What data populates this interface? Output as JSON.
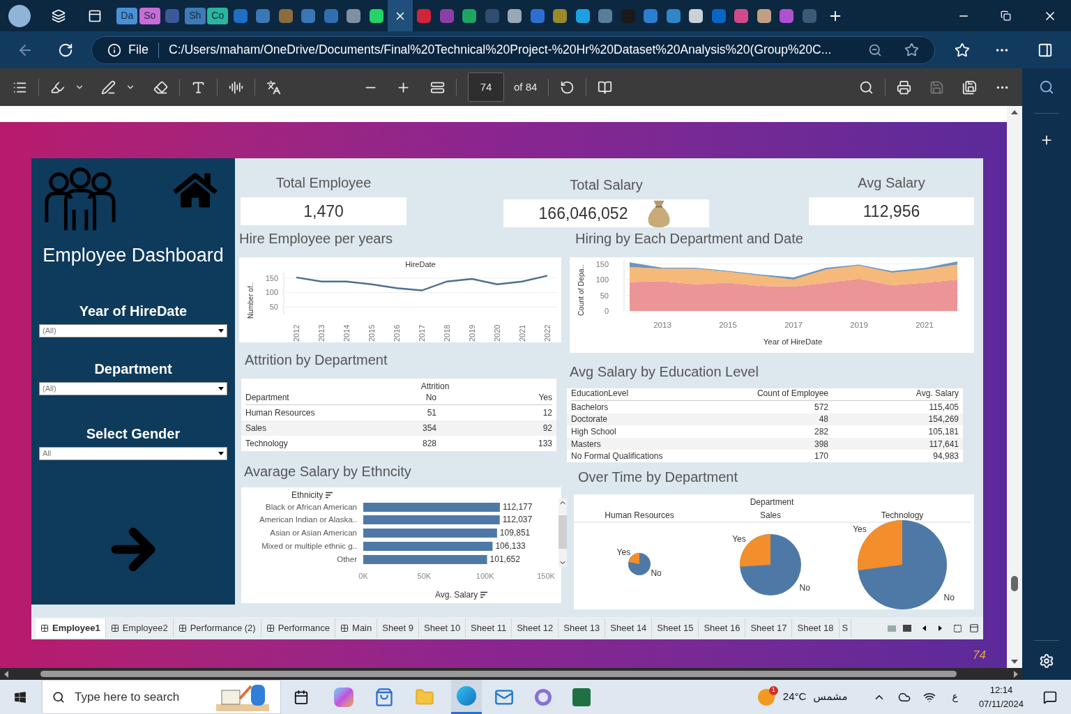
{
  "browser": {
    "tabs": [
      {
        "label": "Da",
        "color": "#4a90d9",
        "selected": false
      },
      {
        "label": "So",
        "color": "#c86dd7",
        "selected": false
      },
      {
        "color": "#3b5998",
        "selected": false
      },
      {
        "label": "Sh",
        "color": "#3d7ab8",
        "selected": false
      },
      {
        "label": "Co",
        "color": "#2bb5a0",
        "selected": false
      },
      {
        "color": "#1f6fc5",
        "selected": false
      },
      {
        "color": "#3a78b5",
        "selected": false
      },
      {
        "color": "#8a6d3b",
        "selected": false
      },
      {
        "color": "#3a78b5",
        "selected": false
      },
      {
        "color": "#2f6fb0",
        "selected": false
      },
      {
        "color": "#8090a0",
        "selected": false
      },
      {
        "color": "#25d366",
        "selected": false
      },
      {
        "selected": true
      },
      {
        "color": "#d0243a",
        "selected": false
      },
      {
        "color": "#8a3fa8",
        "selected": false
      },
      {
        "color": "#1fa463",
        "selected": false
      },
      {
        "color": "#2f4e6d",
        "selected": false
      },
      {
        "color": "#9aa7b4",
        "selected": false
      },
      {
        "color": "#2d6fd0",
        "selected": false
      },
      {
        "color": "#9a8a2a",
        "selected": false
      },
      {
        "color": "#1ea0e0",
        "selected": false
      },
      {
        "color": "#5a7d9a",
        "selected": false
      },
      {
        "color": "#1a1a1a",
        "selected": false
      },
      {
        "color": "#2a7fd0",
        "selected": false
      },
      {
        "color": "#2f86c8",
        "selected": false
      },
      {
        "color": "#c9d1d9",
        "selected": false
      },
      {
        "color": "#0a66c2",
        "selected": false
      },
      {
        "color": "#d04a8a",
        "selected": false
      },
      {
        "color": "#c0a080",
        "selected": false
      },
      {
        "color": "#b050d0",
        "selected": false
      },
      {
        "color": "#3a5a7a",
        "selected": false
      }
    ],
    "file_label": "File",
    "address": "C:/Users/maham/OneDrive/Documents/Final%20Technical%20Project-%20Hr%20Dataset%20Analysis%20(Group%20C...",
    "page": "74",
    "page_total": "of 84"
  },
  "dashboard": {
    "title": "Employee Dashboard",
    "filters": [
      {
        "label": "Year of HireDate",
        "value": "(All)"
      },
      {
        "label": "Department",
        "value": "(All)"
      },
      {
        "label": "Select Gender",
        "value": "All"
      }
    ],
    "kpis": [
      {
        "label": "Total Employee",
        "value": "1,470"
      },
      {
        "label": "Total Salary",
        "value": "166,046,052"
      },
      {
        "label": "Avg Salary",
        "value": "112,956"
      }
    ],
    "hire_chart": {
      "heading": "Hire Employee per years",
      "chart_data": {
        "type": "line",
        "title": "HireDate",
        "ylabel": "Number of..",
        "categories": [
          "2012",
          "2013",
          "2014",
          "2015",
          "2016",
          "2017",
          "2018",
          "2019",
          "2020",
          "2021",
          "2022"
        ],
        "series": [
          {
            "color": "#4e6f8f",
            "values": [
              152,
              138,
              138,
              128,
              115,
              107,
              138,
              147,
              128,
              138,
              158
            ]
          }
        ],
        "grid": true,
        "ylim": [
          25,
          170
        ],
        "yticks": [
          50,
          100,
          150
        ]
      }
    },
    "dept_chart": {
      "heading": "Hiring by Each Department and Date",
      "chart_data": {
        "type": "area",
        "stacked": true,
        "xlabel": "Year of HireDate",
        "ylabel": "Count of Depa..",
        "x": [
          2012,
          2013,
          2014,
          2015,
          2016,
          2017,
          2018,
          2019,
          2020,
          2021,
          2022
        ],
        "series": [
          {
            "color": "#ec9597",
            "values": [
              92,
              95,
              85,
              90,
              80,
              78,
              90,
              103,
              82,
              90,
              100
            ]
          },
          {
            "color": "#f5b97a",
            "values": [
              48,
              40,
              50,
              35,
              33,
              22,
              43,
              42,
              40,
              42,
              48
            ]
          },
          {
            "color": "#6f93b8",
            "values": [
              15,
              3,
              3,
              3,
              3,
              7,
              5,
              3,
              5,
              5,
              10
            ]
          }
        ],
        "grid": true,
        "xlim": [
          2012,
          2022
        ],
        "ylim": [
          0,
          160
        ],
        "xticks": [
          2013,
          2015,
          2017,
          2019,
          2021
        ],
        "yticks": [
          0,
          50,
          100,
          150
        ]
      }
    },
    "attrition": {
      "heading": "Attrition by Department",
      "group_header": "Attrition",
      "columns": [
        "Department",
        "No",
        "Yes"
      ],
      "rows": [
        [
          "Human Resources",
          "51",
          "12"
        ],
        [
          "Sales",
          "354",
          "92"
        ],
        [
          "Technology",
          "828",
          "133"
        ]
      ]
    },
    "education": {
      "heading": "Avg Salary by Education Level",
      "columns": [
        "EducationLevel",
        "Count of Employee",
        "Avg. Salary"
      ],
      "rows": [
        [
          "Bachelors",
          "572",
          "115,405"
        ],
        [
          "Doctorate",
          "48",
          "154,269"
        ],
        [
          "High School",
          "282",
          "105,181"
        ],
        [
          "Masters",
          "398",
          "117,641"
        ],
        [
          "No Formal Qualifications",
          "170",
          "94,983"
        ]
      ]
    },
    "ethnicity_chart": {
      "heading": "Avarage Salary by Ethncity",
      "chart_data": {
        "type": "bar",
        "orientation": "horizontal",
        "ylabel": "Ethnicity",
        "xlabel": "Avg. Salary",
        "categories": [
          "Black or African American",
          "American Indian or Alaska..",
          "Asian or Asian American",
          "Mixed or multiple ethnic g..",
          "Other"
        ],
        "series": [
          {
            "color": "#4e79a7",
            "values": [
              112177,
              112037,
              109851,
              106133,
              101652
            ]
          }
        ],
        "xlim": [
          0,
          150000
        ],
        "value_labels": [
          "112,177",
          "112,037",
          "109,851",
          "106,133",
          "101,652"
        ],
        "xticks": [
          {
            "value": 0,
            "label": "0K"
          },
          {
            "value": 50000,
            "label": "50K"
          },
          {
            "value": 100000,
            "label": "100K"
          },
          {
            "value": 150000,
            "label": "150K"
          }
        ]
      }
    },
    "overtime": {
      "heading": "Over Time by Department",
      "group_header": "Department",
      "pies": [
        {
          "department": "Human Resources",
          "yes_label": "Yes",
          "no_label": "No"
        },
        {
          "department": "Sales",
          "yes_label": "Yes",
          "no_label": "No"
        },
        {
          "department": "Technology",
          "yes_label": "Yes",
          "no_label": "No"
        }
      ]
    },
    "sheet_tabs": [
      {
        "label": "Employee1",
        "kind": "dashboard",
        "selected": true
      },
      {
        "label": "Employee2",
        "kind": "dashboard",
        "selected": false
      },
      {
        "label": "Performance (2)",
        "kind": "dashboard",
        "selected": false
      },
      {
        "label": "Performance",
        "kind": "dashboard",
        "selected": false
      },
      {
        "label": "Main",
        "kind": "dashboard",
        "selected": false
      },
      {
        "label": "Sheet 9",
        "kind": "sheet",
        "selected": false
      },
      {
        "label": "Sheet 10",
        "kind": "sheet",
        "selected": false
      },
      {
        "label": "Sheet 11",
        "kind": "sheet",
        "selected": false
      },
      {
        "label": "Sheet 12",
        "kind": "sheet",
        "selected": false
      },
      {
        "label": "Sheet 13",
        "kind": "sheet",
        "selected": false
      },
      {
        "label": "Sheet 14",
        "kind": "sheet",
        "selected": false
      },
      {
        "label": "Sheet 15",
        "kind": "sheet",
        "selected": false
      },
      {
        "label": "Sheet 16",
        "kind": "sheet",
        "selected": false
      },
      {
        "label": "Sheet 17",
        "kind": "sheet",
        "selected": false
      },
      {
        "label": "Sheet 18",
        "kind": "sheet",
        "selected": false
      },
      {
        "label": "S",
        "kind": "sheet",
        "selected": false
      }
    ],
    "slide_number": "74"
  },
  "taskbar": {
    "search_placeholder": "Type here to search",
    "weather_badge": "1",
    "temperature": "24°C",
    "weather_text": "مشمس",
    "language": "ع",
    "time": "12:14",
    "date": "07/11/2024"
  }
}
